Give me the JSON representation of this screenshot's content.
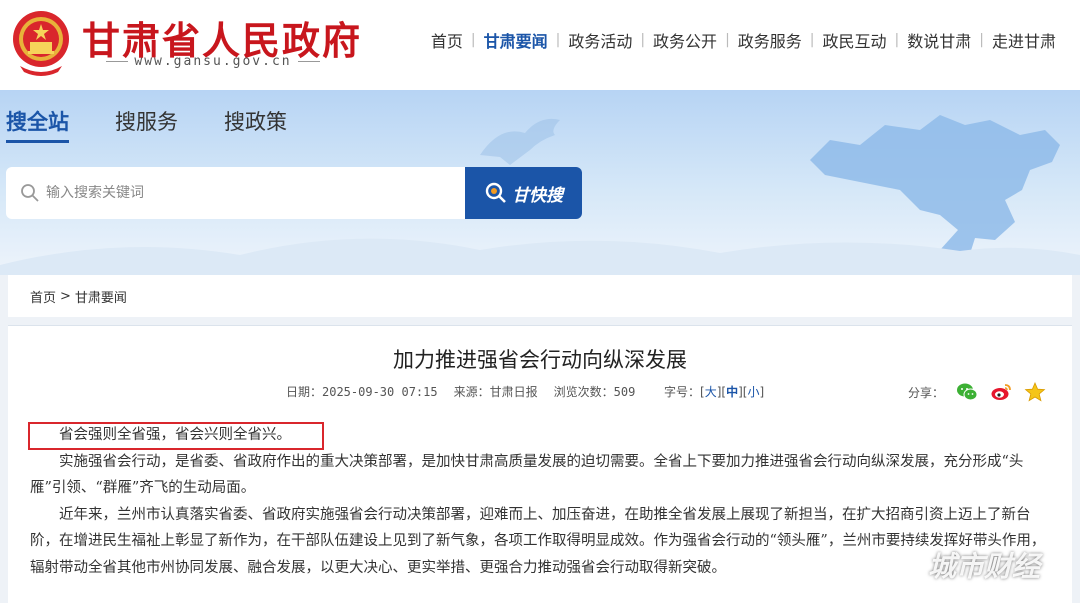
{
  "header": {
    "site_title": "甘肃省人民政府",
    "site_url": "www.gansu.gov.cn",
    "emblem_icon": "national-emblem-icon",
    "nav": [
      {
        "label": "首页"
      },
      {
        "label": "甘肃要闻",
        "active": true
      },
      {
        "label": "政务活动"
      },
      {
        "label": "政务公开"
      },
      {
        "label": "政务服务"
      },
      {
        "label": "政民互动"
      },
      {
        "label": "数说甘肃"
      },
      {
        "label": "走进甘肃"
      }
    ],
    "brand_color": "#c8161d",
    "accent_color": "#1b55a8"
  },
  "search": {
    "tabs": [
      {
        "label": "搜全站",
        "active": true
      },
      {
        "label": "搜服务"
      },
      {
        "label": "搜政策"
      }
    ],
    "placeholder": "输入搜索关键词",
    "button_label": "甘快搜"
  },
  "breadcrumb": {
    "home": "首页",
    "separator": ">",
    "current": "甘肃要闻"
  },
  "article": {
    "title": "加力推进强省会行动向纵深发展",
    "date": "日期：2025-09-30 07:15",
    "source": "来源：甘肃日报",
    "views": "浏览次数：509",
    "font_size_label": "字号：",
    "font_sizes": [
      "大",
      "中",
      "小"
    ],
    "share_label": "分享：",
    "share_icons": [
      "wechat-icon",
      "weibo-icon",
      "favorite-star-icon"
    ],
    "paragraphs": [
      "省会强则全省强，省会兴则全省兴。",
      "实施强省会行动，是省委、省政府作出的重大决策部署，是加快甘肃高质量发展的迫切需要。全省上下要加力推进强省会行动向纵深发展，充分形成“头雁”引领、“群雁”齐飞的生动局面。",
      "近年来，兰州市认真落实省委、省政府实施强省会行动决策部署，迎难而上、加压奋进，在助推全省发展上展现了新担当，在扩大招商引资上迈上了新台阶，在增进民生福祉上彰显了新作为，在干部队伍建设上见到了新气象，各项工作取得明显成效。作为强省会行动的“领头雁”，兰州市要持续发挥好带头作用，辐射带动全省其他市州协同发展、融合发展，以更大决心、更实举措、更强合力推动强省会行动取得新突破。"
    ]
  },
  "watermark": "城市财经"
}
